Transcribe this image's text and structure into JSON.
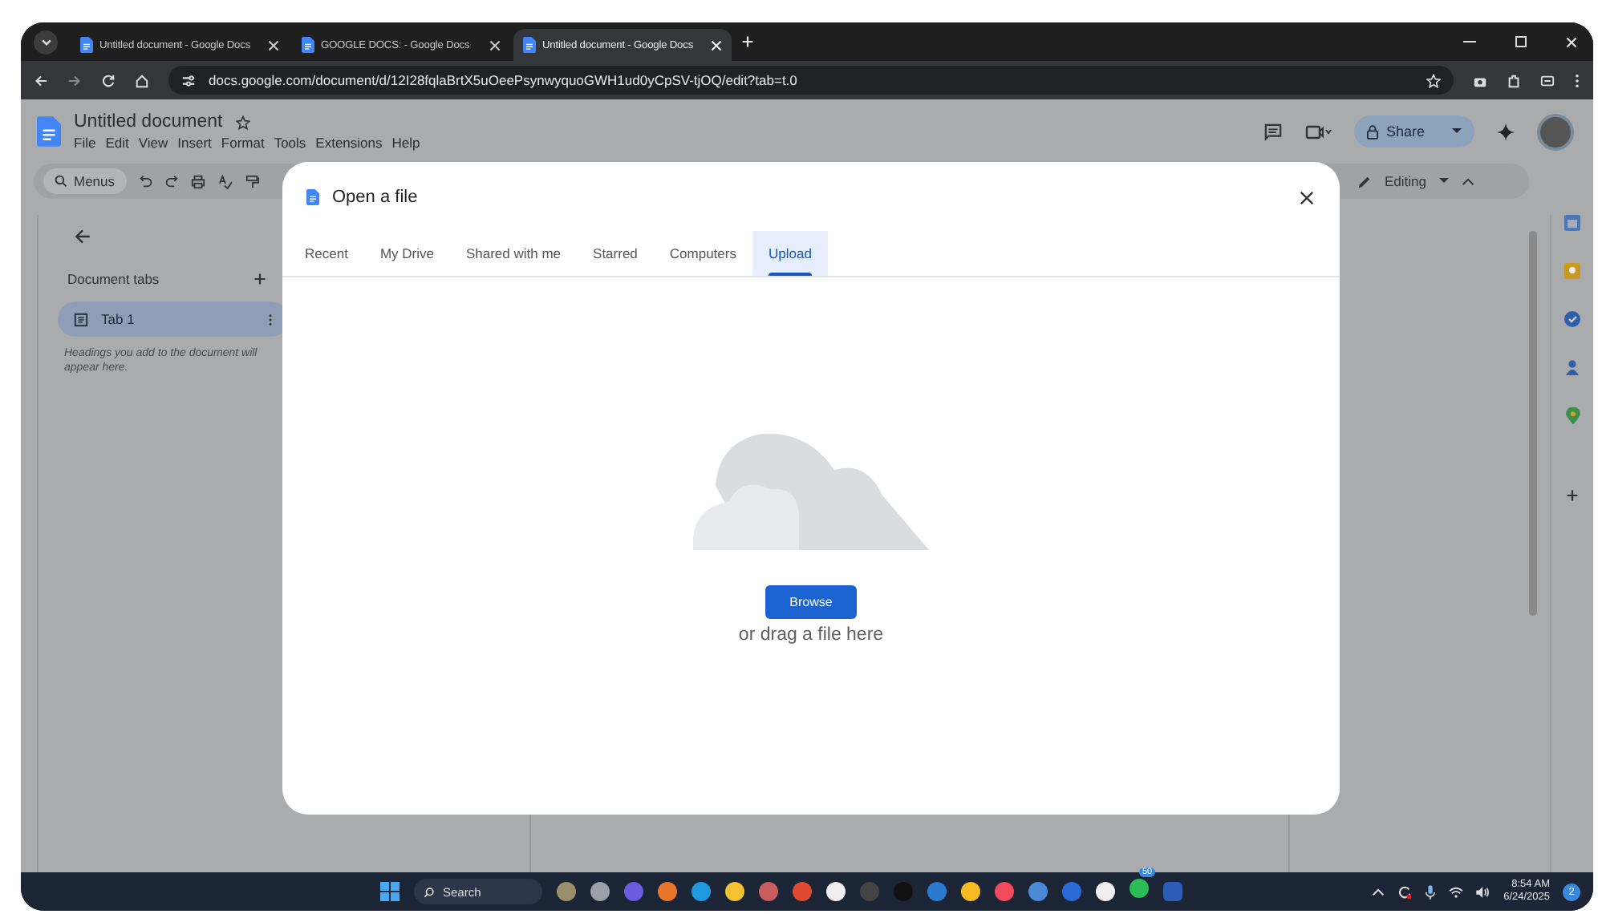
{
  "browser": {
    "tabs": [
      {
        "title": "Untitled document - Google Docs",
        "selected": false
      },
      {
        "title": "GOOGLE DOCS: - Google Docs",
        "selected": false
      },
      {
        "title": "Untitled document - Google Docs",
        "selected": true
      }
    ],
    "url": "docs.google.com/document/d/12I28fqlaBrtX5uOeePsynwyquoGWH1ud0yCpSV-tjOQ/edit?tab=t.0"
  },
  "document": {
    "title": "Untitled document",
    "menus": [
      "File",
      "Edit",
      "View",
      "Insert",
      "Format",
      "Tools",
      "Extensions",
      "Help"
    ],
    "search": "Menus",
    "mode": "Editing",
    "share": "Share",
    "sidebar": {
      "heading": "Document tabs",
      "tabs": [
        {
          "label": "Tab 1",
          "selected": true
        }
      ],
      "hint": "Headings you add to the document will appear here."
    }
  },
  "dialog": {
    "title": "Open a file",
    "tabs": [
      {
        "label": "Recent",
        "selected": false
      },
      {
        "label": "My Drive",
        "selected": false
      },
      {
        "label": "Shared with me",
        "selected": false
      },
      {
        "label": "Starred",
        "selected": false
      },
      {
        "label": "Computers",
        "selected": false
      },
      {
        "label": "Upload",
        "selected": true
      }
    ],
    "button": "Browse",
    "hint": "or drag a file here"
  },
  "taskbar": {
    "search": "Search",
    "badge": "50",
    "time": "8:54 AM",
    "date": "6/24/2025",
    "notifications": "2"
  }
}
